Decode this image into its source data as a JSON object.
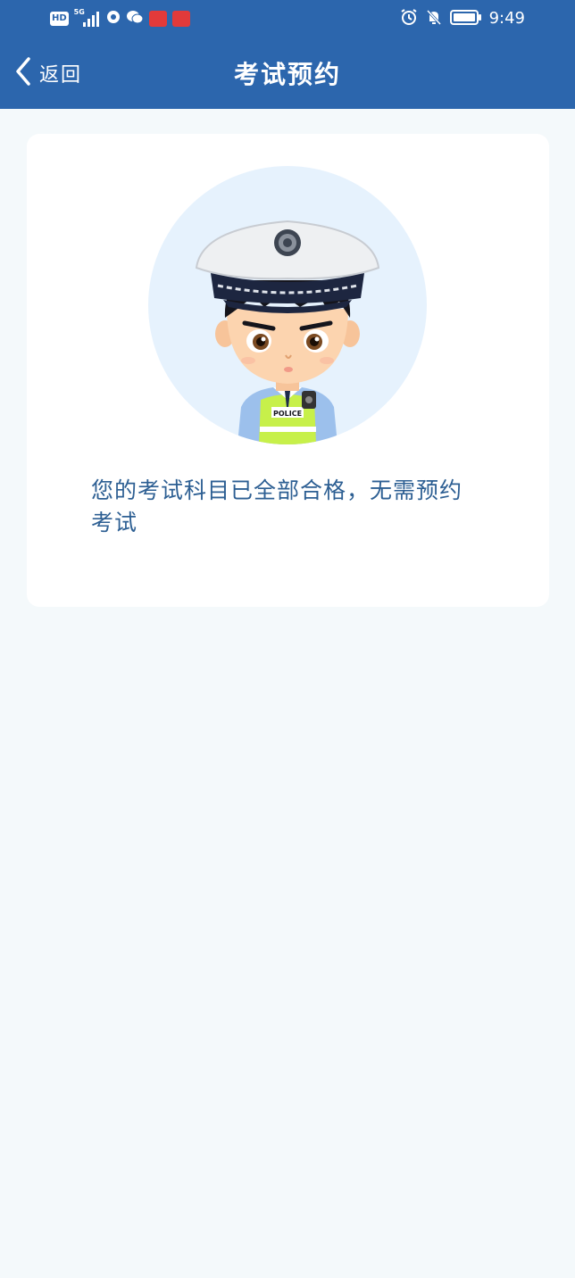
{
  "status_bar": {
    "network_badge": "HD",
    "network_type": "5G",
    "time": "9:49",
    "icons": [
      "signal-icon",
      "vpn-icon",
      "wechat-icon",
      "video-app-icon",
      "reader-app-icon",
      "alarm-icon",
      "mute-icon",
      "battery-icon"
    ]
  },
  "header": {
    "back_label": "返回",
    "title": "考试预约"
  },
  "card": {
    "illustration": "traffic-police-avatar",
    "badge_text": "POLICE",
    "message": "您的考试科目已全部合格，无需预约考试"
  },
  "colors": {
    "header_bg": "#2c66ad",
    "page_bg": "#f4f9fb",
    "card_bg": "#ffffff",
    "message_text": "#2d5f93",
    "avatar_circle": "#e6f2fd"
  }
}
